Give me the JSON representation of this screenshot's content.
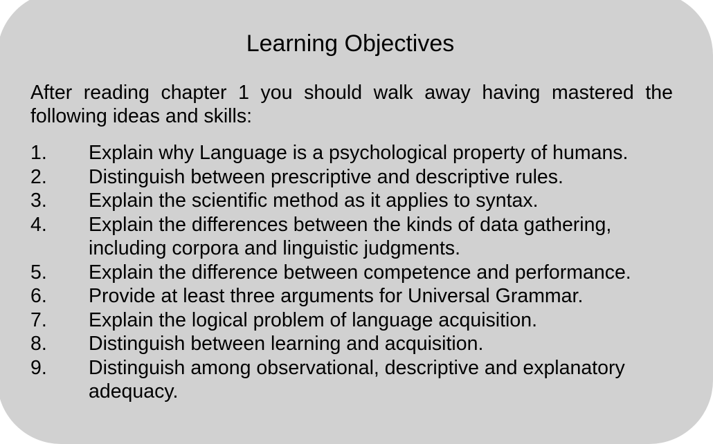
{
  "title": "Learning Objectives",
  "intro": "After reading chapter 1 you should walk away having mastered the following ideas and skills:",
  "objectives": [
    {
      "num": "1.",
      "text": "Explain why Language is a psychological property of humans."
    },
    {
      "num": "2.",
      "text": "Distinguish between prescriptive and descriptive rules."
    },
    {
      "num": "3.",
      "text": "Explain the scientific method as it applies to syntax."
    },
    {
      "num": "4.",
      "text": "Explain the differences between the kinds of data gathering, including corpora and linguistic judgments."
    },
    {
      "num": "5.",
      "text": "Explain the difference between competence and performance."
    },
    {
      "num": "6.",
      "text": "Provide at least three arguments for Universal Grammar."
    },
    {
      "num": "7.",
      "text": "Explain the logical problem of language acquisition."
    },
    {
      "num": "8.",
      "text": "Distinguish between learning and acquisition."
    },
    {
      "num": "9.",
      "text": "Distinguish among observational, descriptive and explanatory adequacy."
    }
  ],
  "colors": {
    "panel_background": "#d1d1d1",
    "text": "#000000"
  }
}
